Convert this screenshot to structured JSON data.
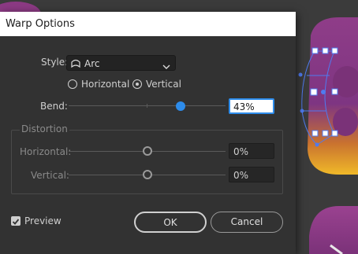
{
  "dialog": {
    "title": "Warp Options",
    "style": {
      "label": "Style:",
      "value": "Arc",
      "icon": "arc-style-icon"
    },
    "orientation": {
      "horizontal_label": "Horizontal",
      "vertical_label": "Vertical",
      "selected": "Vertical"
    },
    "bend": {
      "label": "Bend:",
      "value": "43%",
      "fraction": 0.715
    },
    "distortion": {
      "group_label": "Distortion",
      "horizontal": {
        "label": "Horizontal:",
        "value": "0%",
        "fraction": 0.5
      },
      "vertical": {
        "label": "Vertical:",
        "value": "0%",
        "fraction": 0.5
      }
    },
    "preview": {
      "label": "Preview",
      "checked": true
    },
    "ok_label": "OK",
    "cancel_label": "Cancel"
  },
  "colors": {
    "accent": "#2d8ceb",
    "selection": "#4f7bf0",
    "artwork_top": "#8f3d88",
    "artwork_bottom": "#f0b929"
  }
}
